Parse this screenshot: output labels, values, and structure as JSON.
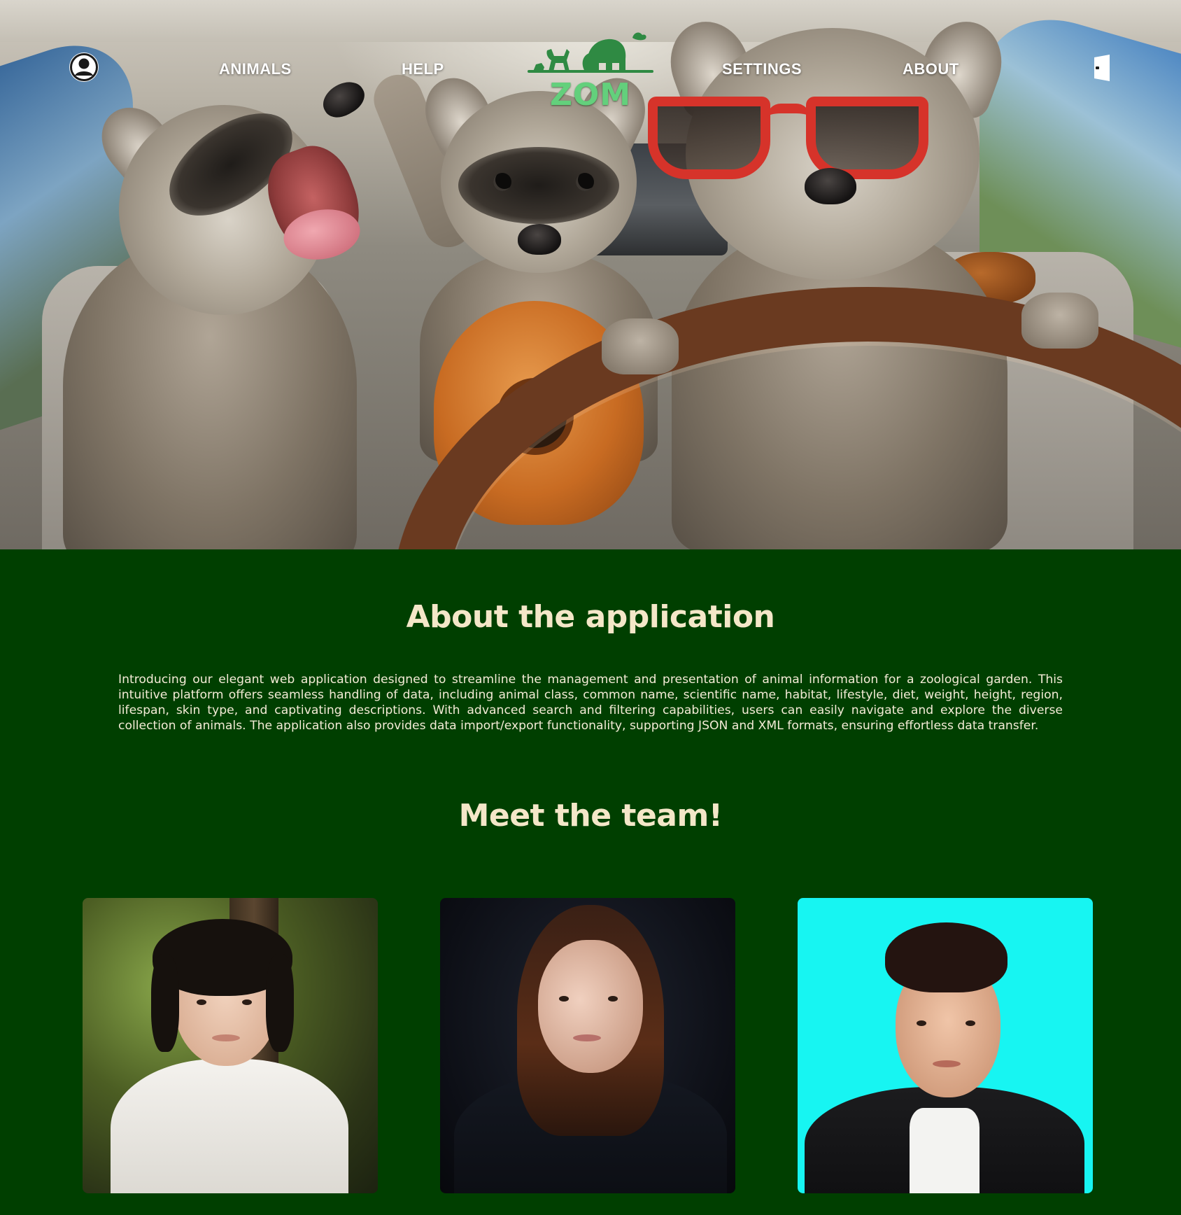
{
  "nav": {
    "animals_label": "ANIMALS",
    "help_label": "HELP",
    "settings_label": "SETTINGS",
    "about_label": "ABOUT",
    "logo_text": "ZOM",
    "icons": {
      "user": "user-icon",
      "exit": "exit-door-icon"
    }
  },
  "hero": {
    "image": "raccoons-in-car"
  },
  "about": {
    "title": "About the application",
    "body": "Introducing our elegant web application designed to streamline the management and presentation of animal information for a zoological garden. This intuitive platform offers seamless handling of data, including animal class, common name, scientific name, habitat, lifestyle, diet, weight, height, region, lifespan, skin type, and captivating descriptions. With advanced search and filtering capabilities, users can easily navigate and explore the diverse collection of animals. The application also provides data import/export functionality, supporting JSON and XML formats, ensuring effortless data transfer."
  },
  "team": {
    "title": "Meet the team!",
    "members": [
      {
        "photo": "team-member-photo-1"
      },
      {
        "photo": "team-member-photo-2"
      },
      {
        "photo": "team-member-photo-3"
      }
    ]
  },
  "colors": {
    "page_background": "#003f00",
    "heading": "#f4e7c8",
    "body_text": "#f4ebd6",
    "logo_green": "#63d07c",
    "nav_text": "#ffffff",
    "member_3_background": "#17f5f2"
  }
}
